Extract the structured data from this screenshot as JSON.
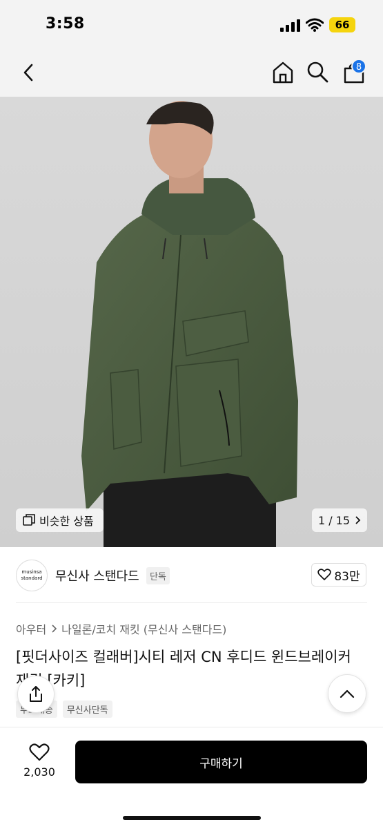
{
  "status": {
    "time": "3:58",
    "battery": "66"
  },
  "nav": {
    "cart_count": "8"
  },
  "image": {
    "similar_label": "비슷한 상품",
    "pager_text": "1 / 15"
  },
  "brand": {
    "logo_line1": "musinsa",
    "logo_line2": "standard",
    "name": "무신사 스탠다드",
    "tag": "단독",
    "likes": "83만"
  },
  "breadcrumb": {
    "level1": "아우터",
    "level2": "나일론/코치 재킷 (무신사 스탠다드)"
  },
  "product": {
    "title": "[핏더사이즈 컬래버]시티 레저 CN 후디드 윈드브레이커 재킷 [카키]",
    "tags": [
      "무료배송",
      "무신사단독"
    ]
  },
  "bottom": {
    "wish_count": "2,030",
    "buy_label": "구매하기"
  },
  "colors": {
    "accent": "#1a73e8",
    "buy_button": "#000000",
    "battery": "#f5d40d",
    "jacket": "#4b5b3e"
  }
}
